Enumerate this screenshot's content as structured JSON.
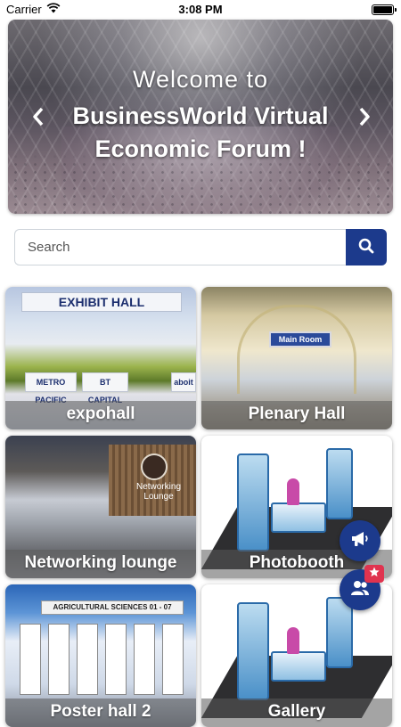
{
  "status_bar": {
    "carrier": "Carrier",
    "time": "3:08 PM",
    "icons": [
      "wifi-icon",
      "battery-icon"
    ]
  },
  "hero": {
    "welcome": "Welcome to",
    "title": "BusinessWorld Virtual Economic Forum !",
    "prev_icon": "chevron-left-icon",
    "next_icon": "chevron-right-icon"
  },
  "search": {
    "placeholder": "Search",
    "value": "",
    "icon": "search-icon"
  },
  "tiles": [
    {
      "label": "expohall",
      "image_text": [
        "EXHIBIT HALL",
        "METRO PACIFIC",
        "BT CAPITAL",
        "aboit"
      ]
    },
    {
      "label": "Plenary Hall",
      "image_text": [
        "Main Room"
      ]
    },
    {
      "label": "Networking lounge",
      "image_text": [
        "Networking",
        "Lounge"
      ]
    },
    {
      "label": "Photobooth",
      "image_text": []
    },
    {
      "label": "Poster hall 2",
      "image_text": [
        "AGRICULTURAL SCIENCES 01 - 07"
      ]
    },
    {
      "label": "Gallery",
      "image_text": []
    }
  ],
  "fabs": {
    "announce_icon": "megaphone-icon",
    "people_icon": "people-icon",
    "badge_icon": "star-icon"
  },
  "colors": {
    "primary": "#1c3a8c",
    "badge": "#e0334f"
  }
}
